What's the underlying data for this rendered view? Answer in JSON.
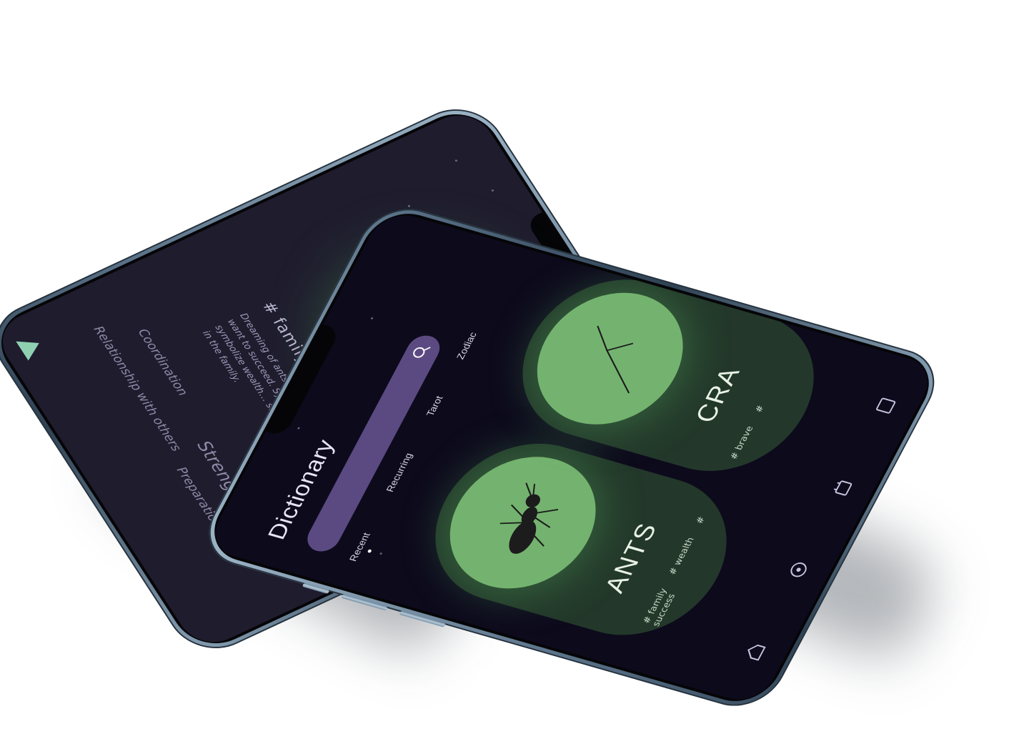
{
  "detail_screen": {
    "tag": "# family",
    "description": "Dreaming of ants … work on certain asp… want to succeed. Sym… in your house, they symbolize wealth… success, and good health in the family.",
    "keywords": {
      "coordination": "Coordination",
      "strength": "Strength",
      "relationship": "Relationship with others",
      "preparation": "Preparation"
    },
    "play_icon": "play-icon"
  },
  "dictionary_screen": {
    "title": "Dictionary",
    "search": {
      "value": "",
      "icon": "search-icon"
    },
    "tabs": [
      {
        "label": "Recent"
      },
      {
        "label": "Recurring"
      },
      {
        "label": "Tarot"
      },
      {
        "label": "Zodiac"
      }
    ],
    "active_tab": "Recent",
    "cards": [
      {
        "title": "ANTS",
        "tags": [
          "# family",
          "# wealth",
          "# success"
        ]
      },
      {
        "title": "CRA",
        "tags": [
          "# brave",
          "#"
        ]
      }
    ],
    "nav": [
      {
        "icon": "home-icon"
      },
      {
        "icon": "compass-icon"
      },
      {
        "icon": "cards-icon"
      },
      {
        "icon": "book-icon"
      }
    ]
  },
  "colors": {
    "screen_bg": "#0d0a1c",
    "detail_bg": "#1f1c2e",
    "accent_green": "#74b36f",
    "card_bg": "#23382a",
    "search_bg": "#5b4a82",
    "frame": "#5a7288"
  }
}
